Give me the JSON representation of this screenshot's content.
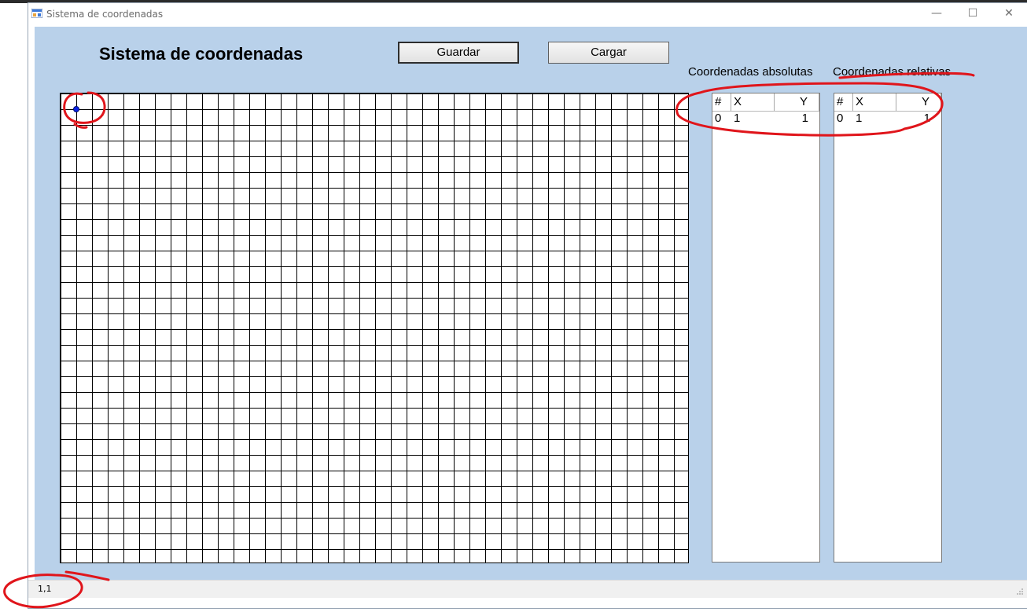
{
  "window": {
    "title": "Sistema de coordenadas",
    "controls": {
      "minimize": "—",
      "maximize": "☐",
      "close": "✕"
    }
  },
  "header": {
    "title": "Sistema de coordenadas",
    "save_label": "Guardar",
    "load_label": "Cargar"
  },
  "lists": {
    "absolute": {
      "label": "Coordenadas absolutas",
      "columns": [
        "#",
        "X",
        "Y"
      ],
      "rows": [
        {
          "index": "0",
          "x": "1",
          "y": "1"
        }
      ]
    },
    "relative": {
      "label": "Coordenadas relativas",
      "columns": [
        "#",
        "X",
        "Y"
      ],
      "rows": [
        {
          "index": "0",
          "x": "1",
          "y": "1"
        }
      ]
    }
  },
  "grid": {
    "columns": 40,
    "rows": 30,
    "point": {
      "x": 1,
      "y": 1
    }
  },
  "status": {
    "text": "1,1"
  },
  "colors": {
    "client_background": "#b9d1ea",
    "point": "#0b22e6",
    "annotation": "#e0151b"
  },
  "icons": [
    "app-icon",
    "minimize-icon",
    "maximize-icon",
    "close-icon",
    "size-grip-icon"
  ]
}
